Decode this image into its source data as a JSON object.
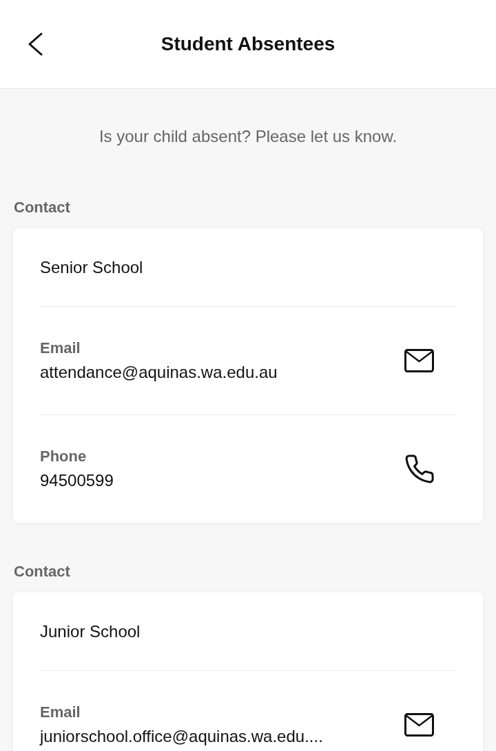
{
  "header": {
    "title": "Student Absentees"
  },
  "intro": "Is your child absent? Please let us know.",
  "sections": [
    {
      "heading": "Contact",
      "name": "Senior School",
      "fields": [
        {
          "kind": "email",
          "label": "Email",
          "value": "attendance@aquinas.wa.edu.au"
        },
        {
          "kind": "phone",
          "label": "Phone",
          "value": "94500599"
        }
      ]
    },
    {
      "heading": "Contact",
      "name": "Junior School",
      "fields": [
        {
          "kind": "email",
          "label": "Email",
          "value": "juniorschool.office@aquinas.wa.edu...."
        }
      ]
    }
  ]
}
